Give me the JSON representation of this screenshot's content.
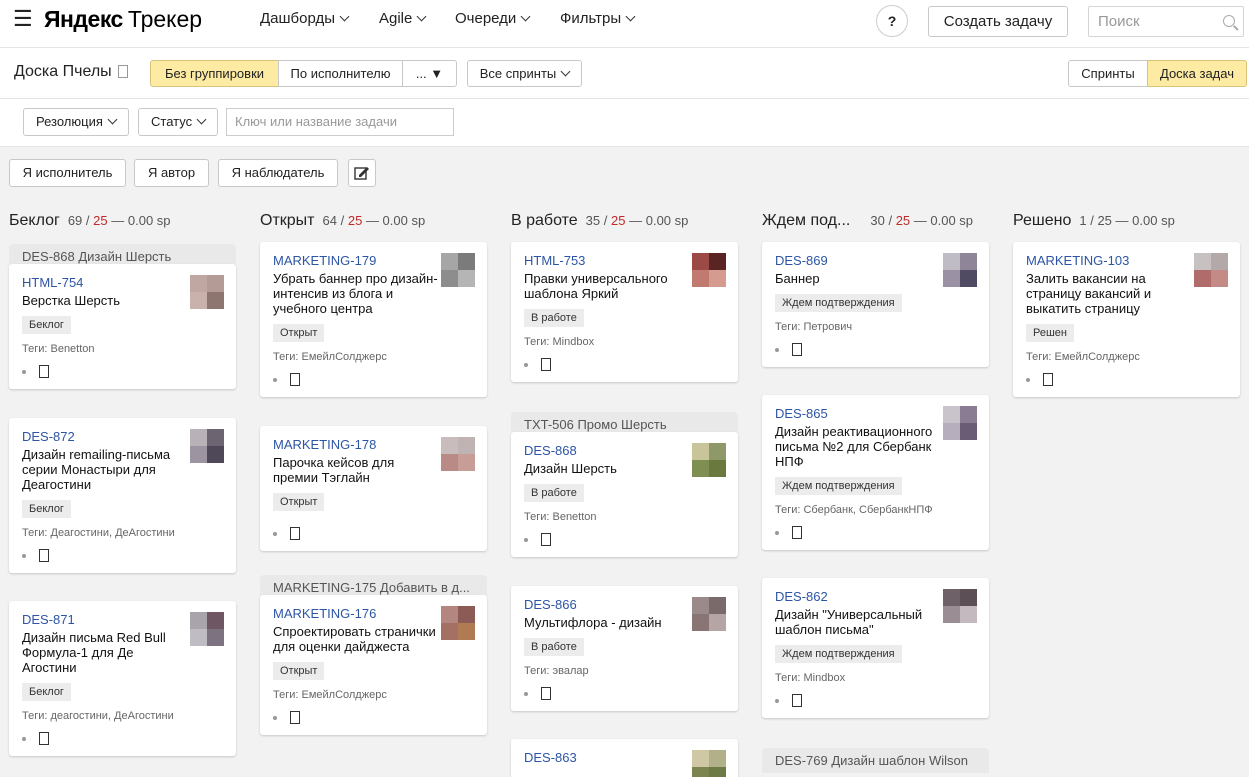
{
  "header": {
    "logo_brand": "Яндекс",
    "logo_product": "Трекер",
    "nav": [
      "Дашборды",
      "Agile",
      "Очереди",
      "Фильтры"
    ],
    "help": "?",
    "create_button": "Создать задачу",
    "search_placeholder": "Поиск"
  },
  "board": {
    "title": "Доска Пчелы",
    "grouping": [
      "Без группировки",
      "По исполнителю",
      "... ▼"
    ],
    "sprints_filter": "Все спринты",
    "view_sprints": "Спринты",
    "view_board": "Доска задач"
  },
  "filters": {
    "resolution": "Резолюция",
    "status": "Статус",
    "key_placeholder": "Ключ или название задачи",
    "quick": [
      "Я исполнитель",
      "Я автор",
      "Я наблюдатель"
    ]
  },
  "colors": {
    "accent": "#feeba3",
    "link": "#2c55a6",
    "limit": "#c02a2a"
  },
  "columns": [
    {
      "title": "Беклог",
      "count": "69",
      "sep": "/",
      "limit": "25",
      "sp": "— 0.00 sp",
      "groups": [
        "DES-868 Дизайн Шерсть"
      ],
      "cards": [
        {
          "key": "HTML-754",
          "title": "Верстка Шерсть",
          "status": "Беклог",
          "tags": "Теги:  Benetton"
        },
        {
          "key": "DES-872",
          "title": "Дизайн remailing-письма серии Монастыри для Деагостини",
          "status": "Беклог",
          "tags": "Теги:  Деагостини, ДеАгостини"
        },
        {
          "key": "DES-871",
          "title": "Дизайн письма Red Bull Формула-1 для Де Агостини",
          "status": "Беклог",
          "tags": "Теги:  деагостини, ДеАгостини"
        }
      ]
    },
    {
      "title": "Открыт",
      "count": "64",
      "sep": "/",
      "limit": "25",
      "sp": "— 0.00 sp",
      "groups": [
        "MARKETING-175 Добавить в д..."
      ],
      "cards": [
        {
          "key": "MARKETING-179",
          "title": "Убрать баннер про дизайн-интенсив из блога и учебного центра",
          "status": "Открыт",
          "tags": "Теги:  ЕмейлСолджерс"
        },
        {
          "key": "MARKETING-178",
          "title": "Парочка кейсов для премии Тэглайн",
          "status": "Открыт",
          "tags": ""
        },
        {
          "key": "MARKETING-176",
          "title": "Спроектировать странички для оценки дайджеста",
          "status": "Открыт",
          "tags": "Теги:  ЕмейлСолджерс"
        }
      ]
    },
    {
      "title": "В работе",
      "count": "35",
      "sep": "/",
      "limit": "25",
      "sp": "— 0.00 sp",
      "groups": [
        "TXT-506 Промо Шерсть"
      ],
      "cards": [
        {
          "key": "HTML-753",
          "title": "Правки универсального шаблона Яркий",
          "status": "В работе",
          "tags": "Теги:  Mindbox"
        },
        {
          "key": "DES-868",
          "title": "Дизайн Шерсть",
          "status": "В работе",
          "tags": "Теги:  Benetton"
        },
        {
          "key": "DES-866",
          "title": "Мультифлора - дизайн",
          "status": "В работе",
          "tags": "Теги:  эвалар"
        },
        {
          "key": "DES-863",
          "title": "",
          "status": "",
          "tags": ""
        }
      ]
    },
    {
      "title": "Ждем под...",
      "count": "30",
      "sep": "/",
      "limit": "25",
      "sp": "— 0.00 sp",
      "groups": [
        "DES-769 Дизайн шаблон Wilson"
      ],
      "cards": [
        {
          "key": "DES-869",
          "title": "Баннер",
          "status": "Ждем подтверждения",
          "tags": "Теги:  Петрович"
        },
        {
          "key": "DES-865",
          "title": "Дизайн реактивационного письма №2 для Сбербанк НПФ",
          "status": "Ждем подтверждения",
          "tags": "Теги:  Сбербанк, СбербанкНПФ"
        },
        {
          "key": "DES-862",
          "title": "Дизайн \"Универсальный шаблон письма\"",
          "status": "Ждем подтверждения",
          "tags": "Теги:  Mindbox"
        }
      ]
    },
    {
      "title": "Решено",
      "count": "1",
      "sep": "/",
      "limit": "25",
      "sp": "— 0.00 sp",
      "groups": [],
      "cards": [
        {
          "key": "MARKETING-103",
          "title": "Залить вакансии на страницу вакансий и выкатить страницу",
          "status": "Решен",
          "tags": "Теги:  ЕмейлСолджерс"
        }
      ]
    }
  ]
}
